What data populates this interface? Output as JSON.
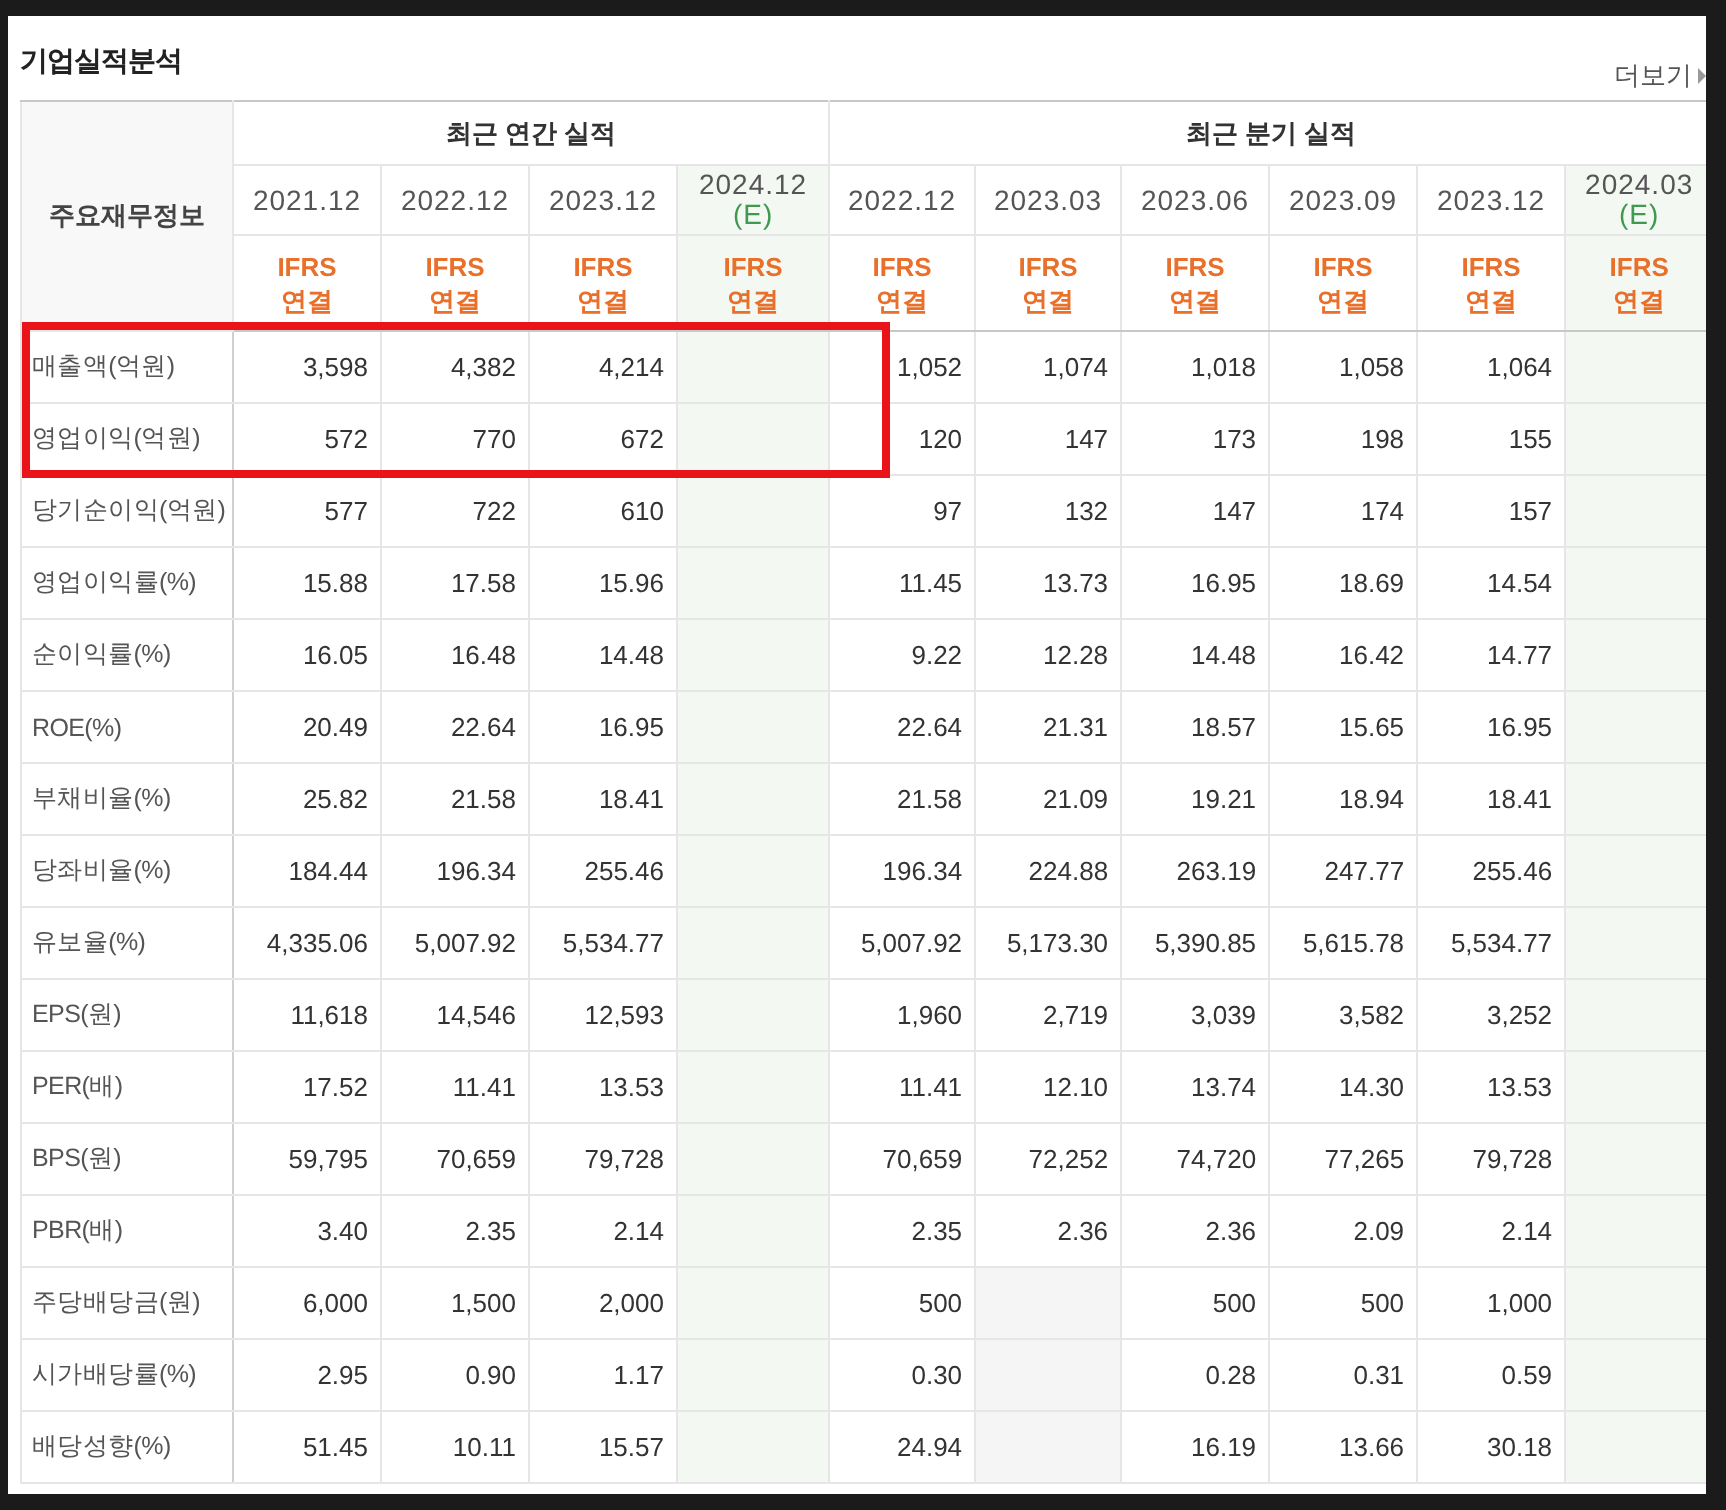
{
  "section": {
    "title": "기업실적분석",
    "more_link": "더보기"
  },
  "table": {
    "corner_label": "주요재무정보",
    "column_groups": [
      {
        "label": "최근 연간 실적",
        "columns": [
          {
            "period": "2021.12",
            "estimate": false,
            "basis": "IFRS",
            "scope": "연결"
          },
          {
            "period": "2022.12",
            "estimate": false,
            "basis": "IFRS",
            "scope": "연결"
          },
          {
            "period": "2023.12",
            "estimate": false,
            "basis": "IFRS",
            "scope": "연결"
          },
          {
            "period": "2024.12",
            "estimate": true,
            "estimate_mark": "(E)",
            "basis": "IFRS",
            "scope": "연결"
          }
        ]
      },
      {
        "label": "최근 분기 실적",
        "columns": [
          {
            "period": "2022.12",
            "estimate": false,
            "basis": "IFRS",
            "scope": "연결"
          },
          {
            "period": "2023.03",
            "estimate": false,
            "basis": "IFRS",
            "scope": "연결"
          },
          {
            "period": "2023.06",
            "estimate": false,
            "basis": "IFRS",
            "scope": "연결"
          },
          {
            "period": "2023.09",
            "estimate": false,
            "basis": "IFRS",
            "scope": "연결"
          },
          {
            "period": "2023.12",
            "estimate": false,
            "basis": "IFRS",
            "scope": "연결"
          },
          {
            "period": "2024.03",
            "estimate": true,
            "estimate_mark": "(E)",
            "basis": "IFRS",
            "scope": "연결"
          }
        ]
      }
    ],
    "row_groups": [
      {
        "rows": [
          {
            "label": "매출액(억원)",
            "highlighted": true,
            "cells": [
              "3,598",
              "4,382",
              "4,214",
              null,
              "1,052",
              "1,074",
              "1,018",
              "1,058",
              "1,064",
              null
            ]
          },
          {
            "label": "영업이익(억원)",
            "highlighted": true,
            "cells": [
              "572",
              "770",
              "672",
              null,
              "120",
              "147",
              "173",
              "198",
              "155",
              null
            ]
          },
          {
            "label": "당기순이익(억원)",
            "highlighted": false,
            "cells": [
              "577",
              "722",
              "610",
              null,
              "97",
              "132",
              "147",
              "174",
              "157",
              null
            ]
          }
        ]
      },
      {
        "rows": [
          {
            "label": "영업이익률(%)",
            "highlighted": false,
            "cells": [
              "15.88",
              "17.58",
              "15.96",
              null,
              "11.45",
              "13.73",
              "16.95",
              "18.69",
              "14.54",
              null
            ]
          },
          {
            "label": "순이익률(%)",
            "highlighted": false,
            "cells": [
              "16.05",
              "16.48",
              "14.48",
              null,
              "9.22",
              "12.28",
              "14.48",
              "16.42",
              "14.77",
              null
            ]
          },
          {
            "label": "ROE(%)",
            "highlighted": false,
            "cells": [
              "20.49",
              "22.64",
              "16.95",
              null,
              "22.64",
              "21.31",
              "18.57",
              "15.65",
              "16.95",
              null
            ]
          }
        ]
      },
      {
        "rows": [
          {
            "label": "부채비율(%)",
            "highlighted": false,
            "cells": [
              "25.82",
              "21.58",
              "18.41",
              null,
              "21.58",
              "21.09",
              "19.21",
              "18.94",
              "18.41",
              null
            ]
          },
          {
            "label": "당좌비율(%)",
            "highlighted": false,
            "cells": [
              "184.44",
              "196.34",
              "255.46",
              null,
              "196.34",
              "224.88",
              "263.19",
              "247.77",
              "255.46",
              null
            ]
          },
          {
            "label": "유보율(%)",
            "highlighted": false,
            "cells": [
              "4,335.06",
              "5,007.92",
              "5,534.77",
              null,
              "5,007.92",
              "5,173.30",
              "5,390.85",
              "5,615.78",
              "5,534.77",
              null
            ]
          }
        ]
      },
      {
        "rows": [
          {
            "label": "EPS(원)",
            "highlighted": false,
            "cells": [
              "11,618",
              "14,546",
              "12,593",
              null,
              "1,960",
              "2,719",
              "3,039",
              "3,582",
              "3,252",
              null
            ]
          },
          {
            "label": "PER(배)",
            "highlighted": false,
            "cells": [
              "17.52",
              "11.41",
              "13.53",
              null,
              "11.41",
              "12.10",
              "13.74",
              "14.30",
              "13.53",
              null
            ]
          },
          {
            "label": "BPS(원)",
            "highlighted": false,
            "cells": [
              "59,795",
              "70,659",
              "79,728",
              null,
              "70,659",
              "72,252",
              "74,720",
              "77,265",
              "79,728",
              null
            ]
          },
          {
            "label": "PBR(배)",
            "highlighted": false,
            "cells": [
              "3.40",
              "2.35",
              "2.14",
              null,
              "2.35",
              "2.36",
              "2.36",
              "2.09",
              "2.14",
              null
            ]
          }
        ]
      },
      {
        "rows": [
          {
            "label": "주당배당금(원)",
            "highlighted": false,
            "cells": [
              "6,000",
              "1,500",
              "2,000",
              null,
              "500",
              null,
              "500",
              "500",
              "1,000",
              null
            ]
          },
          {
            "label": "시가배당률(%)",
            "highlighted": false,
            "cells": [
              "2.95",
              "0.90",
              "1.17",
              null,
              "0.30",
              null,
              "0.28",
              "0.31",
              "0.59",
              null
            ]
          },
          {
            "label": "배당성향(%)",
            "highlighted": false,
            "cells": [
              "51.45",
              "10.11",
              "15.57",
              null,
              "24.94",
              null,
              "16.19",
              "13.66",
              "30.18",
              null
            ]
          }
        ]
      }
    ]
  }
}
